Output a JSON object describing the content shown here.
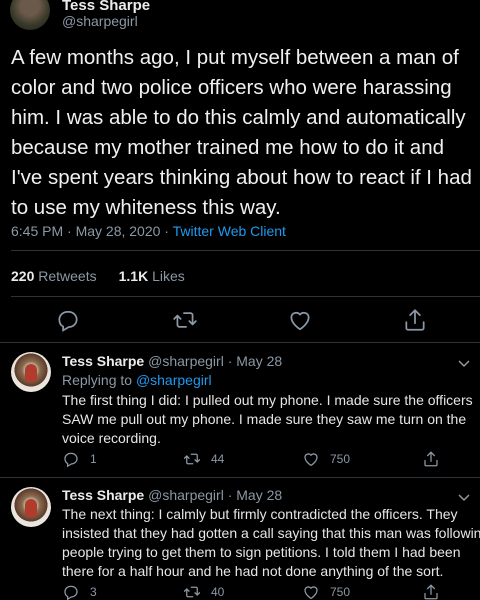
{
  "main": {
    "name": "Tess Sharpe",
    "handle": "@sharpegirl",
    "text_lines": [
      "A few months ago, I put myself between a man of",
      "color and two police officers who were harassing",
      "him. I was able to do this calmly and automatically",
      "because my mother trained me how to do it and",
      "I've spent years thinking about how to react if I had",
      "to use my whiteness this way."
    ],
    "time": "6:45 PM · May 28, 2020 · ",
    "source": "Twitter Web Client",
    "retweets_count": "220",
    "retweets_label": "Retweets",
    "likes_count": "1.1K",
    "likes_label": "Likes"
  },
  "replies": [
    {
      "name": "Tess Sharpe",
      "handle_date": "@sharpegirl · May 28",
      "replying_prefix": "Replying to ",
      "replying_to": "@sharpegirl",
      "text_lines": [
        "The first thing I did: I pulled out my phone. I made sure the officers",
        "SAW me pull out my phone. I made sure they saw me turn on the",
        "voice recording."
      ],
      "replies": "1",
      "retweets": "44",
      "likes": "750"
    },
    {
      "name": "Tess Sharpe",
      "handle_date": "@sharpegirl · May 28",
      "text_lines": [
        "The next thing: I calmly but firmly contradicted the officers. They",
        "insisted that they had gotten a call saying that this man was following",
        "people trying to get them to sign petitions. I told them I had been",
        "there for a half hour and he had not done anything of the sort."
      ],
      "replies": "3",
      "retweets": "40",
      "likes": "750"
    }
  ],
  "icons": {
    "reply": "reply-icon",
    "retweet": "retweet-icon",
    "like": "heart-icon",
    "share": "share-icon",
    "more": "chevron-down-icon"
  },
  "colors": {
    "background": "#000000",
    "link": "#1d9bf0",
    "muted": "#8b98a5",
    "divider": "#2f3336"
  }
}
